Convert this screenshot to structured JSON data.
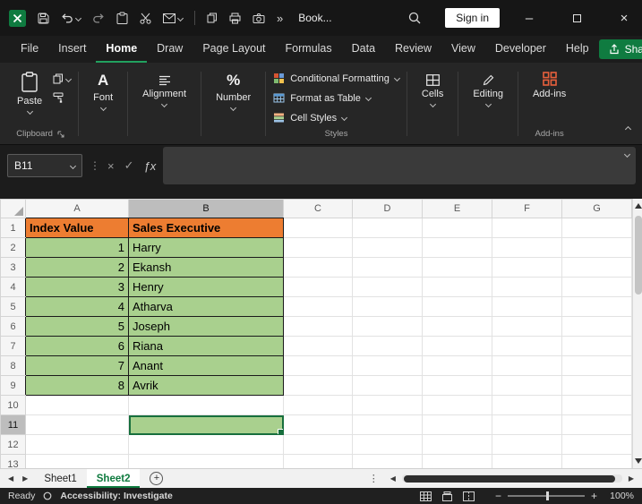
{
  "titlebar": {
    "workbook_title": "Book...",
    "sign_in_label": "Sign in"
  },
  "menubar": {
    "tabs": [
      "File",
      "Insert",
      "Home",
      "Draw",
      "Page Layout",
      "Formulas",
      "Data",
      "Review",
      "View",
      "Developer",
      "Help"
    ],
    "active_tab": "Home",
    "share_label": "Share"
  },
  "ribbon": {
    "paste_label": "Paste",
    "clipboard_group_label": "Clipboard",
    "font_label": "Font",
    "alignment_label": "Alignment",
    "number_label": "Number",
    "styles_buttons": [
      "Conditional Formatting",
      "Format as Table",
      "Cell Styles"
    ],
    "styles_group_label": "Styles",
    "cells_label": "Cells",
    "editing_label": "Editing",
    "addins_label": "Add-ins",
    "addins_group_label": "Add-ins"
  },
  "formula_bar": {
    "name_box_value": "B11",
    "formula_value": ""
  },
  "sheet": {
    "column_headers": [
      "A",
      "B",
      "C",
      "D",
      "E",
      "F",
      "G"
    ],
    "row_count": 13,
    "selected_cell": {
      "column": "B",
      "row": 11
    },
    "table_header": [
      "Index Value",
      "Sales Executive"
    ],
    "table_rows": [
      {
        "index": "1",
        "name": "Harry"
      },
      {
        "index": "2",
        "name": "Ekansh"
      },
      {
        "index": "3",
        "name": "Henry"
      },
      {
        "index": "4",
        "name": "Atharva"
      },
      {
        "index": "5",
        "name": "Joseph"
      },
      {
        "index": "6",
        "name": "Riana"
      },
      {
        "index": "7",
        "name": "Anant"
      },
      {
        "index": "8",
        "name": "Avrik"
      }
    ]
  },
  "sheet_tabs": {
    "tabs": [
      "Sheet1",
      "Sheet2"
    ],
    "active_tab": "Sheet2"
  },
  "status_bar": {
    "mode": "Ready",
    "accessibility": "Accessibility: Investigate",
    "zoom_level": "100%"
  },
  "glyphs": {
    "minimize": "–",
    "close": "×",
    "overflow": "»",
    "dots_vertical": "⋮",
    "cancel": "×",
    "enter": "✓",
    "fx": "ƒx",
    "font_big_a": "A",
    "number_icon": "%",
    "nav_left": "◀",
    "nav_right": "▶",
    "add_sheet": "+",
    "zoom_out": "−",
    "zoom_in": "+"
  },
  "colors": {
    "excel_green": "#107C41",
    "share_button_green": "#0F7B40",
    "table_header_orange": "#ED7D31",
    "table_row_green": "#A9D08E",
    "selection_border_green": "#176F3D",
    "addins_icon_orange": "#E8603C"
  }
}
